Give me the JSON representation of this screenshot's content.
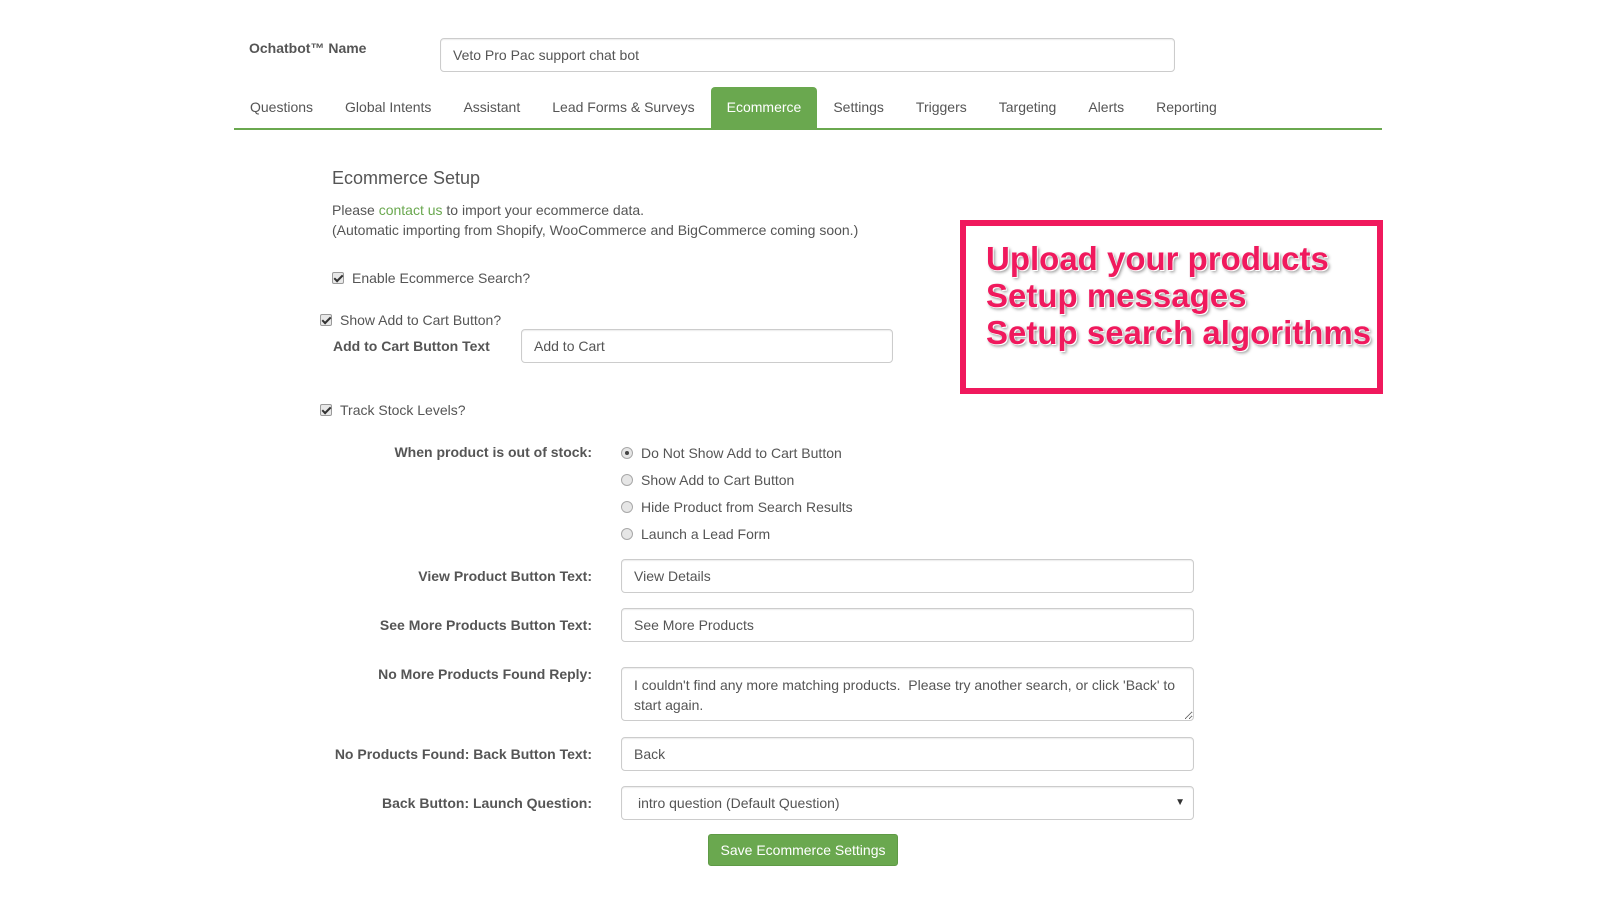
{
  "bot_name": {
    "label": "Ochatbot™ Name",
    "value": "Veto Pro Pac support chat bot"
  },
  "tabs": [
    {
      "label": "Questions",
      "active": false
    },
    {
      "label": "Global Intents",
      "active": false
    },
    {
      "label": "Assistant",
      "active": false
    },
    {
      "label": "Lead Forms & Surveys",
      "active": false
    },
    {
      "label": "Ecommerce",
      "active": true
    },
    {
      "label": "Settings",
      "active": false
    },
    {
      "label": "Triggers",
      "active": false
    },
    {
      "label": "Targeting",
      "active": false
    },
    {
      "label": "Alerts",
      "active": false
    },
    {
      "label": "Reporting",
      "active": false
    }
  ],
  "ecommerce": {
    "title": "Ecommerce Setup",
    "intro_prefix": "Please ",
    "intro_link": "contact us",
    "intro_suffix": " to import your ecommerce data.",
    "intro_note": "(Automatic importing from Shopify, WooCommerce and BigCommerce coming soon.)",
    "enable_search": {
      "label": "Enable Ecommerce Search?",
      "checked": true
    },
    "show_add_to_cart": {
      "label": "Show Add to Cart Button?",
      "checked": true
    },
    "add_to_cart_text": {
      "label": "Add to Cart Button Text",
      "value": "Add to Cart"
    },
    "track_stock": {
      "label": "Track Stock Levels?",
      "checked": true
    },
    "out_of_stock": {
      "label": "When product is out of stock:",
      "options": [
        {
          "label": "Do Not Show Add to Cart Button",
          "selected": true
        },
        {
          "label": "Show Add to Cart Button",
          "selected": false
        },
        {
          "label": "Hide Product from Search Results",
          "selected": false
        },
        {
          "label": "Launch a Lead Form",
          "selected": false
        }
      ]
    },
    "view_product_text": {
      "label": "View Product Button Text:",
      "value": "View Details"
    },
    "see_more_text": {
      "label": "See More Products Button Text:",
      "value": "See More Products"
    },
    "no_more_reply": {
      "label": "No More Products Found Reply:",
      "value": "I couldn't find any more matching products.  Please try another search, or click 'Back' to start again."
    },
    "back_button_text": {
      "label": "No Products Found: Back Button Text:",
      "value": "Back"
    },
    "back_launch_question": {
      "label": "Back Button: Launch Question:",
      "value": "intro question (Default Question)"
    },
    "save_label": "Save Ecommerce Settings"
  },
  "callout": {
    "lines": [
      "Upload your products",
      "Setup messages",
      "Setup search algorithms"
    ],
    "color": "#f0195d"
  },
  "colors": {
    "accent": "#6aa84f",
    "text": "#555555"
  }
}
